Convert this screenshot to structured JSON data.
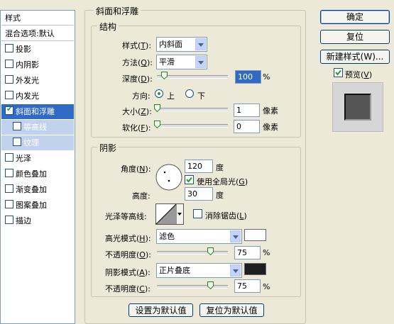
{
  "styles_panel": {
    "title": "样式",
    "items": [
      {
        "label": "混合选项:默认",
        "checkbox": false,
        "checked": false,
        "state": "header"
      },
      {
        "label": "投影",
        "checkbox": true,
        "checked": false,
        "state": "normal"
      },
      {
        "label": "内阴影",
        "checkbox": true,
        "checked": false,
        "state": "normal"
      },
      {
        "label": "外发光",
        "checkbox": true,
        "checked": false,
        "state": "normal"
      },
      {
        "label": "内发光",
        "checkbox": true,
        "checked": false,
        "state": "normal"
      },
      {
        "label": "斜面和浮雕",
        "checkbox": true,
        "checked": true,
        "state": "selected"
      },
      {
        "label": "等高线",
        "checkbox": true,
        "checked": false,
        "state": "sub"
      },
      {
        "label": "纹理",
        "checkbox": true,
        "checked": false,
        "state": "sub"
      },
      {
        "label": "光泽",
        "checkbox": true,
        "checked": false,
        "state": "normal"
      },
      {
        "label": "颜色叠加",
        "checkbox": true,
        "checked": false,
        "state": "normal"
      },
      {
        "label": "渐变叠加",
        "checkbox": true,
        "checked": false,
        "state": "normal"
      },
      {
        "label": "图案叠加",
        "checkbox": true,
        "checked": false,
        "state": "normal"
      },
      {
        "label": "描边",
        "checkbox": true,
        "checked": false,
        "state": "normal"
      }
    ]
  },
  "bevel": {
    "title": "斜面和浮雕",
    "structure": {
      "title": "结构",
      "style_label": "样式(",
      "style_key": "T",
      "style_value": "内斜面",
      "technique_label": "方法(",
      "technique_key": "Q",
      "technique_value": "平滑",
      "depth_label": "深度(",
      "depth_key": "D",
      "depth_value": "100",
      "depth_unit": "%",
      "direction_label": "方向:",
      "direction_up": "上",
      "direction_down": "下",
      "size_label": "大小(",
      "size_key": "Z",
      "size_value": "1",
      "size_unit": "像素",
      "soften_label": "软化(",
      "soften_key": "F",
      "soften_value": "0",
      "soften_unit": "像素"
    },
    "shading": {
      "title": "阴影",
      "angle_label": "角度(",
      "angle_key": "N",
      "angle_value": "120",
      "angle_unit": "度",
      "global_light_label": "使用全局光(",
      "global_light_key": "G",
      "altitude_label": "高度:",
      "altitude_value": "30",
      "altitude_unit": "度",
      "gloss_contour_label": "光泽等高线:",
      "anti_aliased_label": "消除锯齿(",
      "anti_aliased_key": "L",
      "highlight_mode_label": "高光模式(",
      "highlight_mode_key": "H",
      "highlight_mode_value": "滤色",
      "highlight_color": "#ffffff",
      "highlight_opacity_label": "不透明度(",
      "highlight_opacity_key": "O",
      "highlight_opacity_value": "75",
      "shadow_mode_label": "阴影模式(",
      "shadow_mode_key": "A",
      "shadow_mode_value": "正片叠底",
      "shadow_color": "#1e1e1e",
      "shadow_opacity_label": "不透明度(",
      "shadow_opacity_key": "C",
      "shadow_opacity_value": "75",
      "percent": "%"
    },
    "make_default": "设置为默认值",
    "reset_default": "复位为默认值"
  },
  "sliders": {
    "depth": 0.1,
    "size": 0.0,
    "soften": 0.0,
    "highlight_opacity": 0.75,
    "shadow_opacity": 0.75
  },
  "buttons": {
    "ok": "确定",
    "reset": "复位",
    "new_style": "新建样式(W)...",
    "preview_label": "预览(",
    "preview_key": "V"
  },
  "colors": {
    "selected": "#316ac5",
    "sub_item": "#c1d2ee",
    "dialog_bg": "#ece9d8"
  }
}
